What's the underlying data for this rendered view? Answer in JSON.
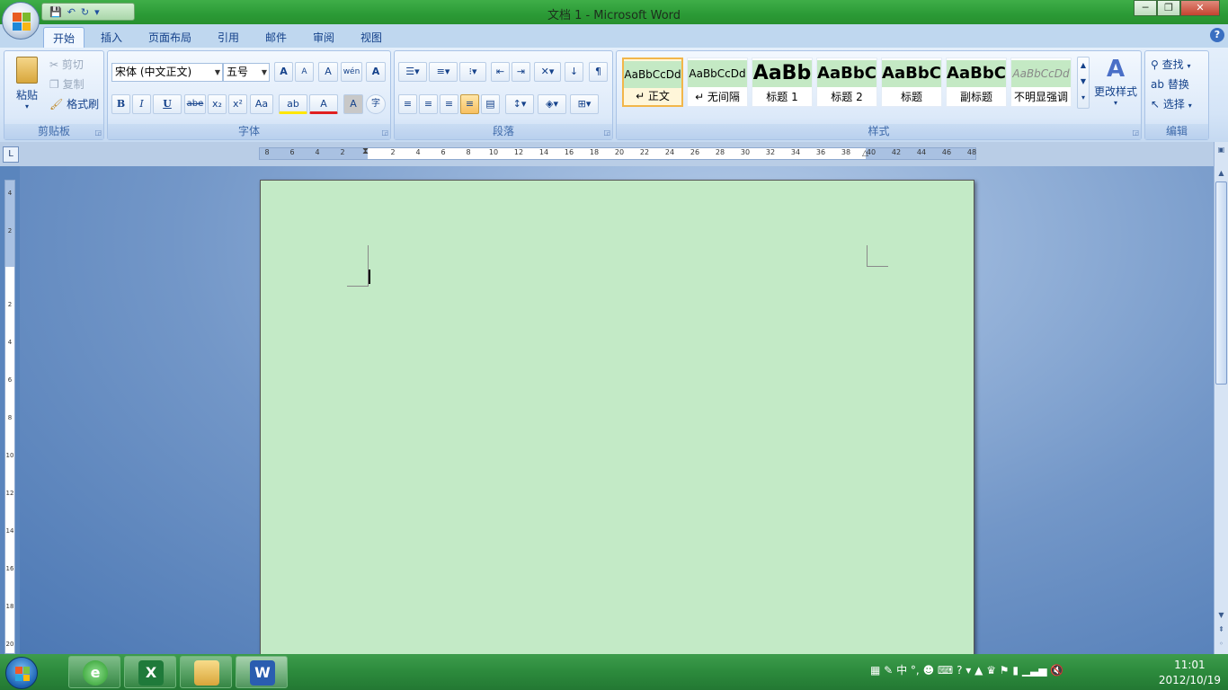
{
  "window": {
    "title": "文档 1 - Microsoft Word",
    "min": "─",
    "max": "❐",
    "close": "✕"
  },
  "qat": {
    "save": "💾",
    "undo": "↶",
    "redo": "↻",
    "more": "▾"
  },
  "tabs": [
    "开始",
    "插入",
    "页面布局",
    "引用",
    "邮件",
    "审阅",
    "视图"
  ],
  "help": "?",
  "clipboard": {
    "paste": "粘贴",
    "cut": "剪切",
    "copy": "复制",
    "format_painter": "格式刷",
    "label": "剪贴板"
  },
  "font": {
    "name": "宋体 (中文正文)",
    "size": "五号",
    "grow": "A",
    "shrink": "A",
    "clear": "A",
    "phonetic": "wén",
    "border": "A",
    "bold": "B",
    "italic": "I",
    "underline": "U",
    "strike": "abe",
    "sub": "x₂",
    "sup": "x²",
    "case": "Aa",
    "highlight": "ab",
    "color": "A",
    "shade": "A",
    "enclose": "字",
    "label": "字体"
  },
  "paragraph": {
    "label": "段落"
  },
  "styles": {
    "items": [
      {
        "preview": "AaBbCcDd",
        "name": "↵ 正文"
      },
      {
        "preview": "AaBbCcDd",
        "name": "↵ 无间隔"
      },
      {
        "preview": "AaBb",
        "name": "标题 1"
      },
      {
        "preview": "AaBbC",
        "name": "标题 2"
      },
      {
        "preview": "AaBbC",
        "name": "标题"
      },
      {
        "preview": "AaBbC",
        "name": "副标题"
      },
      {
        "preview": "AaBbCcDd",
        "name": "不明显强调"
      }
    ],
    "change": "更改样式",
    "label": "样式"
  },
  "editing": {
    "find": "查找",
    "replace": "替换",
    "select": "选择",
    "label": "编辑"
  },
  "ruler": {
    "h_left": [
      "8",
      "6",
      "4",
      "2"
    ],
    "h_right": [
      "2",
      "4",
      "6",
      "8",
      "10",
      "12",
      "14",
      "16",
      "18",
      "20",
      "22",
      "24",
      "26",
      "28",
      "30",
      "32",
      "34",
      "36",
      "38",
      "40",
      "42",
      "44",
      "46",
      "48"
    ],
    "v_top": [
      "4",
      "2"
    ],
    "v_body": [
      "2",
      "4",
      "6",
      "8",
      "10",
      "12",
      "14",
      "16",
      "18",
      "20"
    ],
    "tab_selector": "L"
  },
  "tray": {
    "ime": "中",
    "punct": "°,",
    "time": "11:01",
    "date": "2012/10/19"
  },
  "taskbar": {
    "excel": "X",
    "word": "W"
  }
}
